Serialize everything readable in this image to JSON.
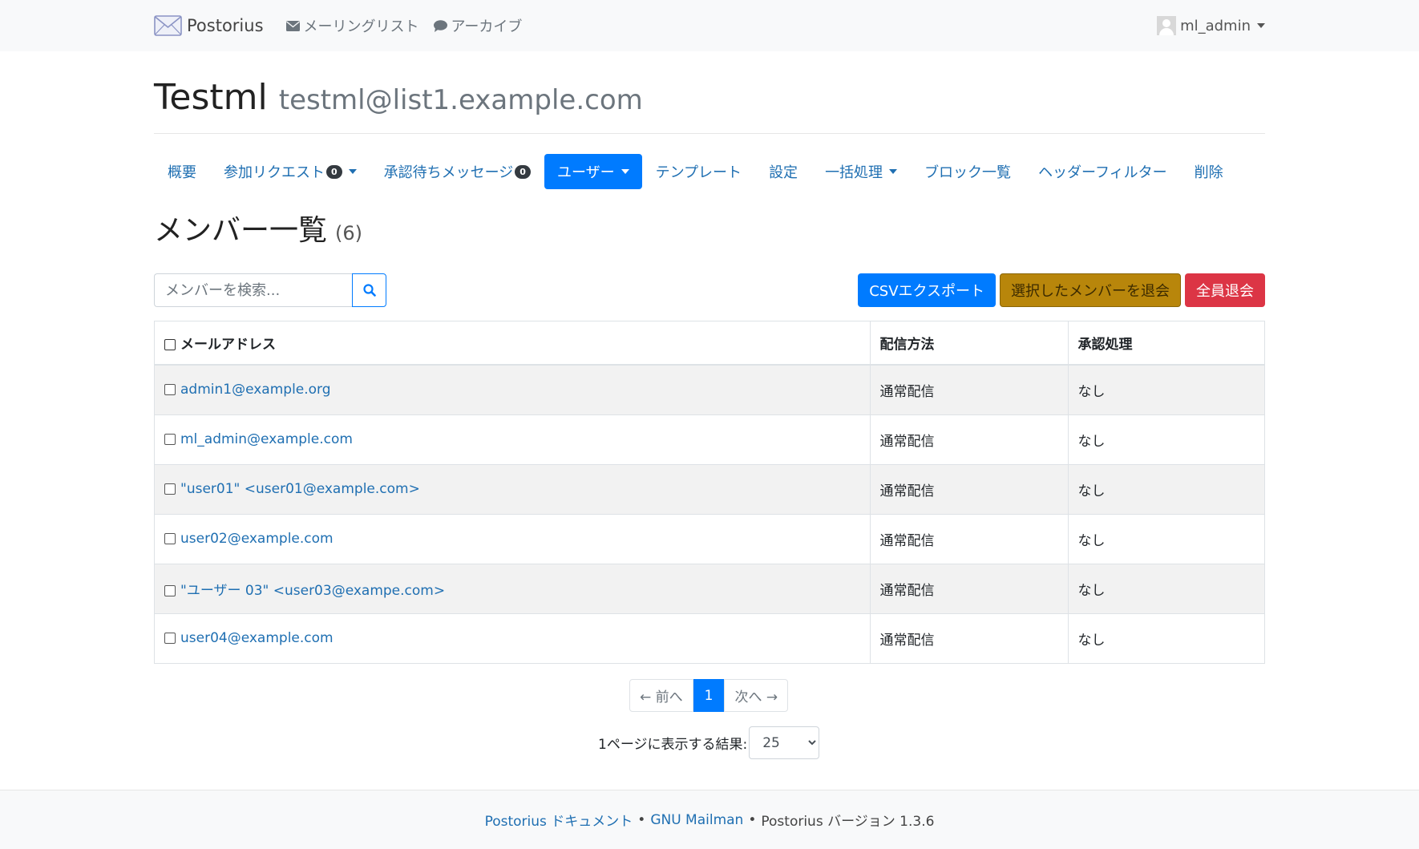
{
  "navbar": {
    "brand": "Postorius",
    "links": [
      {
        "label": "メーリングリスト",
        "icon": "envelope-icon"
      },
      {
        "label": "アーカイブ",
        "icon": "comment-icon"
      }
    ],
    "user": "ml_admin"
  },
  "list": {
    "name": "Testml",
    "address": "testml@list1.example.com"
  },
  "tabs": [
    {
      "label": "概要"
    },
    {
      "label": "参加リクエスト",
      "badge": "0",
      "dropdown": true
    },
    {
      "label": "承認待ちメッセージ",
      "badge": "0"
    },
    {
      "label": "ユーザー",
      "dropdown": true,
      "active": true
    },
    {
      "label": "テンプレート"
    },
    {
      "label": "設定"
    },
    {
      "label": "一括処理",
      "dropdown": true
    },
    {
      "label": "ブロック一覧"
    },
    {
      "label": "ヘッダーフィルター"
    },
    {
      "label": "削除"
    }
  ],
  "page": {
    "title": "メンバー一覧",
    "count": "(6)"
  },
  "search": {
    "placeholder": "メンバーを検索..."
  },
  "actions": {
    "csv_export": "CSVエクスポート",
    "unsubscribe_selected": "選択したメンバーを退会",
    "unsubscribe_all": "全員退会"
  },
  "table": {
    "headers": [
      "メールアドレス",
      "配信方法",
      "承認処理"
    ],
    "rows": [
      {
        "email": "admin1@example.org",
        "delivery": "通常配信",
        "moderation": "なし"
      },
      {
        "email": "ml_admin@example.com",
        "delivery": "通常配信",
        "moderation": "なし"
      },
      {
        "email": "\"user01\" <user01@example.com>",
        "delivery": "通常配信",
        "moderation": "なし"
      },
      {
        "email": "user02@example.com",
        "delivery": "通常配信",
        "moderation": "なし"
      },
      {
        "email": "\"ユーザー 03\" <user03@exampe.com>",
        "delivery": "通常配信",
        "moderation": "なし"
      },
      {
        "email": "user04@example.com",
        "delivery": "通常配信",
        "moderation": "なし"
      }
    ]
  },
  "pagination": {
    "prev": "← 前へ",
    "current": "1",
    "next": "次へ →"
  },
  "per_page": {
    "label": "1ページに表示する結果:",
    "value": "25"
  },
  "footer": {
    "docs_link": "Postorius ドキュメント",
    "mailman_link": "GNU Mailman",
    "version": "Postorius バージョン 1.3.6",
    "separator": "•"
  },
  "colors": {
    "primary": "#007bff",
    "warning": "#b8860b",
    "danger": "#dc3545",
    "link": "#1f6fb2"
  }
}
